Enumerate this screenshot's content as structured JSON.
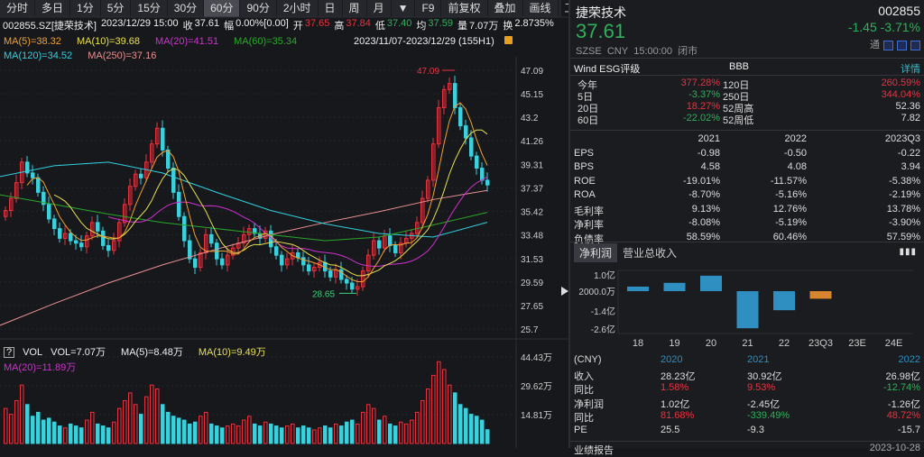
{
  "toolbar": {
    "tabs": [
      "分时",
      "多日",
      "1分",
      "5分",
      "15分",
      "30分",
      "60分",
      "90分",
      "2小时",
      "日",
      "周",
      "月",
      "▼",
      "F9",
      "前复权",
      "叠加",
      "画线",
      "工具",
      ">"
    ],
    "selected": 6
  },
  "info": {
    "code": "002855.SZ[捷荣技术]",
    "datetime": "2023/12/29 15:00",
    "close_label": "收",
    "close": "37.61",
    "amp_label": "幅",
    "amp": "0.00%[0.00]",
    "open_label": "开",
    "open": "37.65",
    "high_label": "高",
    "high": "37.84",
    "low_label": "低",
    "low": "37.40",
    "avg_label": "均",
    "avg": "37.59",
    "vol_label": "量",
    "vol": "7.07万",
    "turn_label": "换",
    "turn": "2.8735%"
  },
  "ma": {
    "ma5": "MA(5)=38.32",
    "ma10": "MA(10)=39.68",
    "ma20": "MA(20)=41.51",
    "ma60": "MA(60)=35.34",
    "ma120": "MA(120)=34.52",
    "ma250": "MA(250)=37.16",
    "range": "2023/11/07-2023/12/29 (155H1)"
  },
  "colors": {
    "up": "#e8333f",
    "down": "#3ad0dc",
    "ma5": "#f0a030",
    "ma10": "#e8e050",
    "ma20": "#d030d0",
    "ma60": "#2aa82a",
    "ma120": "#30d0e0",
    "ma250": "#e89090"
  },
  "vol_header": {
    "help": "?",
    "name": "VOL",
    "vol": "VOL=7.07万",
    "ma5": "MA(5)=8.48万",
    "ma10": "MA(10)=9.49万",
    "ma20": "MA(20)=11.89万"
  },
  "chart_data": {
    "type": "candlestick",
    "price_axis": [
      "47.09",
      "45.15",
      "43.2",
      "41.26",
      "39.31",
      "37.37",
      "35.42",
      "33.48",
      "31.53",
      "29.59",
      "27.65",
      "25.7"
    ],
    "ylim": [
      25.7,
      47.09
    ],
    "vol_axis": [
      "44.43万",
      "29.62万",
      "14.81万"
    ],
    "vol_ylim": [
      0,
      50
    ],
    "max_label": "47.09",
    "min_label": "28.65",
    "close": [
      35.5,
      36.5,
      37.8,
      39.5,
      38.6,
      38.2,
      37.0,
      36.0,
      34.8,
      34.0,
      33.2,
      33.6,
      33.0,
      32.8,
      32.5,
      33.4,
      34.5,
      33.8,
      32.6,
      32.2,
      33.0,
      34.5,
      36.0,
      37.5,
      38.5,
      38.2,
      39.5,
      41.0,
      42.3,
      40.5,
      39.0,
      37.0,
      35.0,
      33.0,
      31.5,
      30.8,
      32.0,
      33.5,
      32.8,
      31.5,
      31.0,
      31.8,
      32.4,
      32.8,
      33.5,
      34.0,
      33.6,
      33.2,
      33.8,
      32.5,
      31.8,
      31.0,
      31.5,
      32.0,
      31.6,
      31.0,
      30.5,
      30.8,
      31.2,
      30.5,
      30.0,
      30.6,
      29.8,
      29.5,
      29.0,
      29.2,
      30.5,
      31.8,
      33.0,
      32.4,
      33.4,
      32.6,
      32.0,
      32.8,
      33.2,
      33.6,
      34.5,
      36.5,
      38.0,
      41.0,
      44.0,
      45.5,
      46.0,
      44.0,
      42.5,
      41.5,
      40.0,
      39.0,
      38.0,
      37.61
    ],
    "volume": [
      18,
      15,
      22,
      30,
      20,
      14,
      16,
      12,
      13,
      11,
      9,
      8,
      10,
      9,
      8,
      12,
      16,
      10,
      9,
      8,
      11,
      18,
      22,
      26,
      20,
      15,
      24,
      30,
      28,
      20,
      16,
      14,
      13,
      12,
      10,
      11,
      14,
      16,
      10,
      9,
      8,
      9,
      10,
      9,
      12,
      14,
      10,
      9,
      11,
      10,
      9,
      8,
      9,
      10,
      8,
      9,
      8,
      7,
      8,
      9,
      8,
      10,
      9,
      11,
      12,
      10,
      16,
      20,
      18,
      12,
      14,
      10,
      9,
      11,
      10,
      12,
      16,
      22,
      28,
      35,
      42,
      38,
      30,
      26,
      20,
      18,
      15,
      14,
      12,
      7.07
    ],
    "ma60_path": [
      36.8,
      36.0,
      35.2,
      34.5,
      34.0,
      33.5,
      33.0,
      33.3,
      34.3,
      35.34
    ],
    "ma120_path": [
      38.3,
      39.2,
      39.5,
      38.6,
      37.0,
      35.5,
      34.4,
      33.6,
      33.3,
      34.52
    ],
    "ma250_path": [
      26.0,
      27.8,
      29.5,
      31.0,
      32.3,
      33.5,
      34.5,
      35.4,
      36.4,
      37.16
    ]
  },
  "quote": {
    "name": "捷荣技术",
    "code": "002855",
    "price": "37.61",
    "change": "-1.45",
    "pct": "-3.71%",
    "exchange": "SZSE",
    "currency": "CNY",
    "time": "15:00:00",
    "status": "闭市",
    "tong": "通"
  },
  "esg": {
    "label": "Wind ESG评级",
    "rating": "BBB",
    "detail": "详情"
  },
  "returns": [
    {
      "l": "今年",
      "v": "377.28%",
      "c": "red",
      "l2": "120日",
      "v2": "260.59%",
      "c2": "red"
    },
    {
      "l": "5日",
      "v": "-3.37%",
      "c": "grn",
      "l2": "250日",
      "v2": "344.04%",
      "c2": "red"
    },
    {
      "l": "20日",
      "v": "18.27%",
      "c": "red",
      "l2": "52周高",
      "v2": "52.36",
      "c2": ""
    },
    {
      "l": "60日",
      "v": "-22.02%",
      "c": "grn",
      "l2": "52周低",
      "v2": "7.82",
      "c2": ""
    }
  ],
  "fin": {
    "headers": [
      "2021",
      "2022",
      "2023Q3"
    ],
    "rows": [
      [
        "EPS",
        "-0.98",
        "-0.50",
        "-0.22"
      ],
      [
        "BPS",
        "4.58",
        "4.08",
        "3.94"
      ],
      [
        "ROE",
        "-19.01%",
        "-11.57%",
        "-5.38%"
      ],
      [
        "ROA",
        "-8.70%",
        "-5.16%",
        "-2.19%"
      ],
      [
        "毛利率",
        "9.13%",
        "12.76%",
        "13.78%"
      ],
      [
        "净利率",
        "-8.08%",
        "-5.19%",
        "-3.90%"
      ],
      [
        "负债率",
        "58.59%",
        "60.46%",
        "57.59%"
      ]
    ]
  },
  "profit_tabs": [
    "净利润",
    "营业总收入"
  ],
  "profit_chart": {
    "type": "bar",
    "axis": [
      "1.0亿",
      "2000.0万",
      "-1.4亿",
      "-2.6亿"
    ],
    "categories": [
      "18",
      "19",
      "20",
      "21",
      "22",
      "23Q3",
      "23E",
      "24E"
    ],
    "values": [
      0.3,
      0.55,
      1.02,
      -2.45,
      -1.26,
      -0.5,
      null,
      null
    ],
    "unit": "亿"
  },
  "summary": {
    "header": [
      "(CNY)",
      "2020",
      "2021",
      "2022"
    ],
    "rows": [
      {
        "l": "收入",
        "v": [
          "28.23亿",
          "30.92亿",
          "26.98亿"
        ],
        "c": [
          "",
          "",
          ""
        ]
      },
      {
        "l": "同比",
        "v": [
          "1.58%",
          "9.53%",
          "-12.74%"
        ],
        "c": [
          "red",
          "red",
          "grn"
        ]
      },
      {
        "l": "净利润",
        "v": [
          "1.02亿",
          "-2.45亿",
          "-1.26亿"
        ],
        "c": [
          "",
          "",
          ""
        ]
      },
      {
        "l": "同比",
        "v": [
          "81.68%",
          "-339.49%",
          "48.72%"
        ],
        "c": [
          "red",
          "grn",
          "red"
        ]
      },
      {
        "l": "PE",
        "v": [
          "25.5",
          "-9.3",
          "-15.7"
        ],
        "c": [
          "",
          "",
          ""
        ]
      }
    ],
    "footer_label": "业绩报告",
    "footer_date": "2023-10-28"
  }
}
